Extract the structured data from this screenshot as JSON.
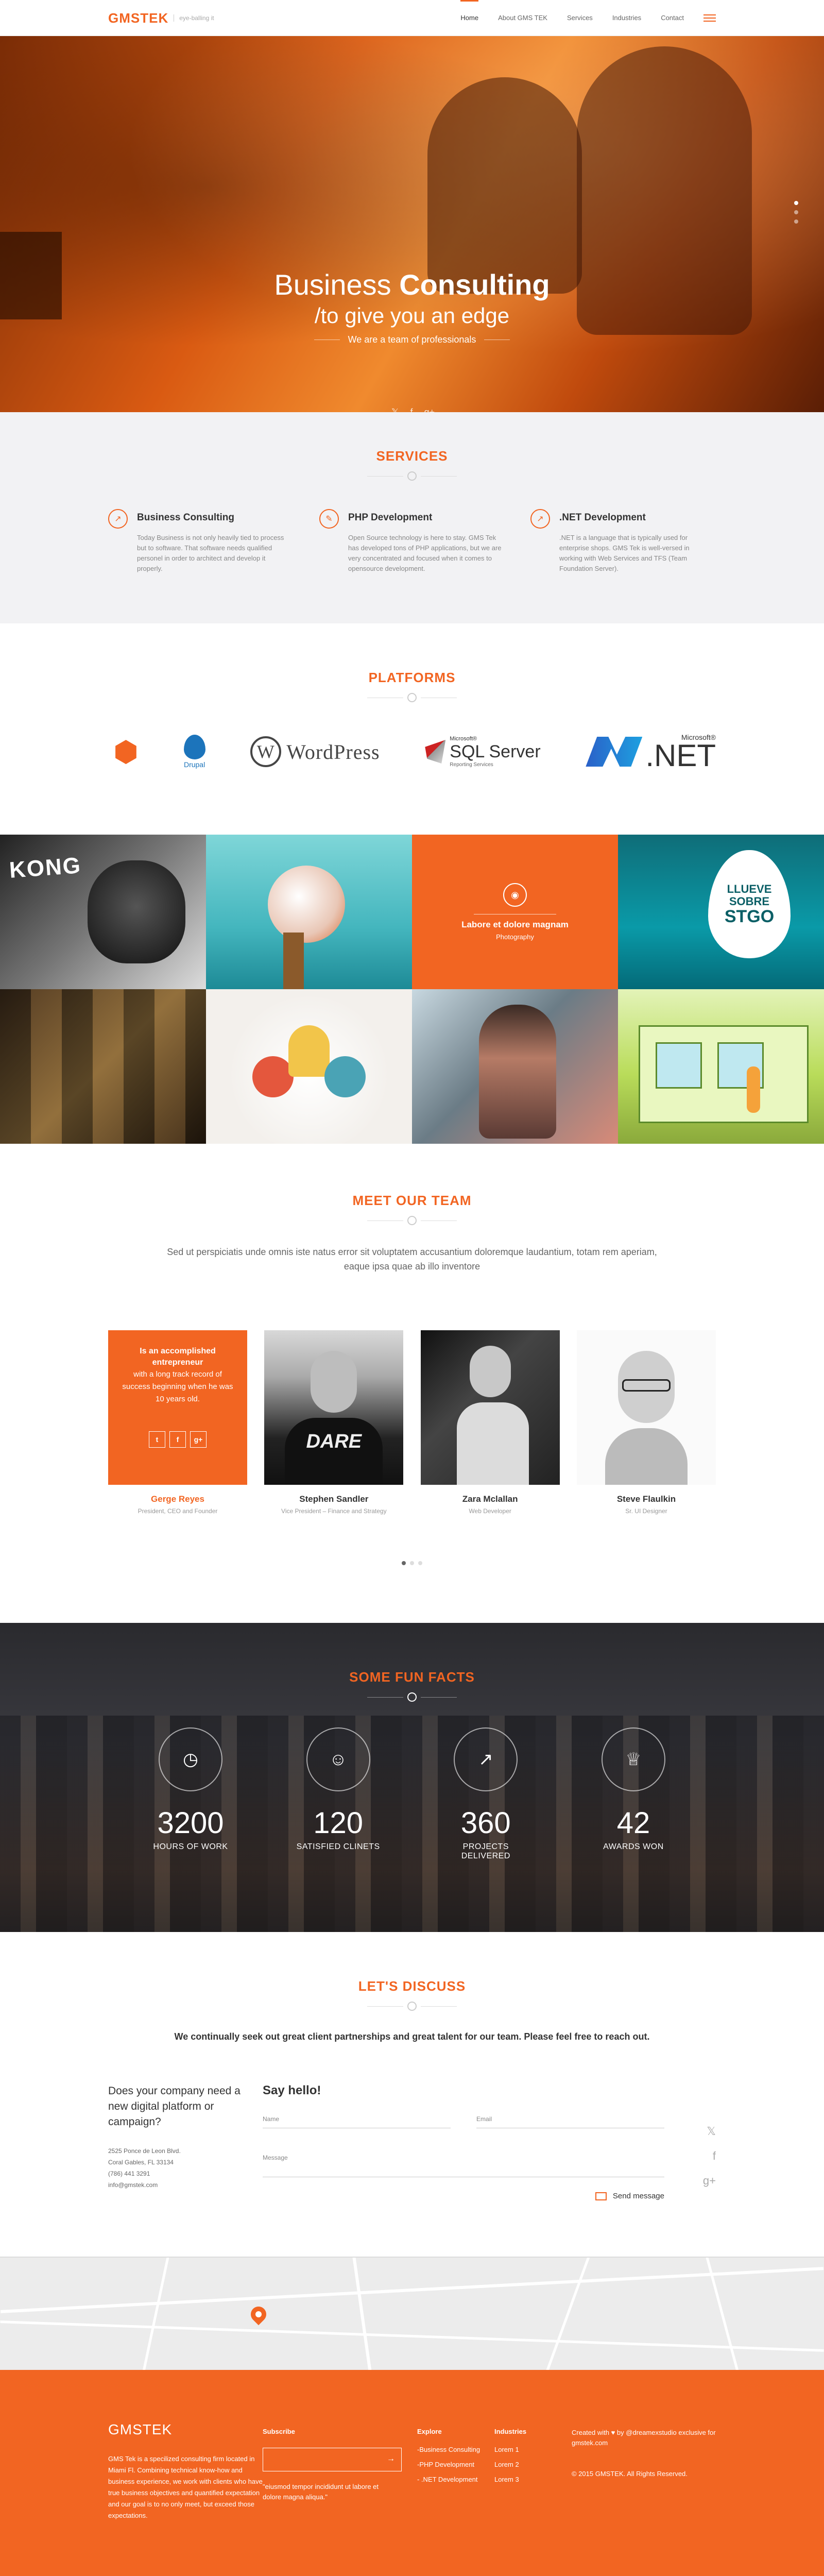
{
  "header": {
    "logo": "GMSTEK",
    "tagline": "eye-balling it",
    "nav": [
      "Home",
      "About GMS TEK",
      "Services",
      "Industries",
      "Contact"
    ]
  },
  "hero": {
    "title_a": "Business",
    "title_b": "Consulting",
    "subtitle": "/to give you an edge",
    "tagline": "We are a team of professionals",
    "social": [
      "twitter-icon",
      "facebook-icon",
      "google-plus-icon"
    ]
  },
  "services": {
    "heading": "SERVICES",
    "items": [
      {
        "title": "Business Consulting",
        "text": "Today Business is not only heavily tied to process but to software. That software needs qualified personel in order to architect and develop it properly.",
        "icon": "rocket-icon"
      },
      {
        "title": "PHP Development",
        "text": "Open Source technology is here to stay. GMS Tek has developed tons of PHP applications, but we are very concentrated and focused when it comes to opensource development.",
        "icon": "pencil-icon"
      },
      {
        "title": ".NET Development",
        "text": ".NET is a language that is typically used for enterprise shops. GMS Tek is well-versed in working with Web Services and TFS (Team Foundation Server).",
        "icon": "rocket-icon"
      }
    ]
  },
  "platforms": {
    "heading": "PLATFORMS",
    "drupal": "Drupal",
    "wordpress": "WordPress",
    "sql_ms": "Microsoft®",
    "sql_big": "SQL Server",
    "sql_rs": "Reporting Services",
    "net_ms": "Microsoft®",
    "net_big": ".NET"
  },
  "portfolio": {
    "kong": "KONG",
    "hover_title": "Labore et dolore magnam",
    "hover_sub": "Photography",
    "drop_1": "LLUEVE",
    "drop_2": "SOBRE",
    "drop_3": "STGO",
    "shirt": "DARE"
  },
  "team": {
    "heading": "MEET OUR TEAM",
    "intro": "Sed ut perspiciatis unde omnis iste natus error sit voluptatem accusantium doloremque laudantium, totam rem aperiam, eaque ipsa quae ab illo inventore",
    "bio_bold": "Is an accomplished entrepreneur",
    "bio_rest": "with a long track record of success beginning when he was 10 years old.",
    "members": [
      {
        "name": "Gerge Reyes",
        "role": "President, CEO and Founder"
      },
      {
        "name": "Stephen Sandler",
        "role": "Vice President – Finance and Strategy"
      },
      {
        "name": "Zara Mclallan",
        "role": "Web Developer"
      },
      {
        "name": "Steve Flaulkin",
        "role": "Sr. UI Designer"
      }
    ]
  },
  "facts": {
    "heading": "SOME FUN FACTS",
    "items": [
      {
        "num": "3200",
        "label": "HOURS OF WORK",
        "icon": "clock-icon"
      },
      {
        "num": "120",
        "label": "SATISFIED CLINETS",
        "icon": "user-icon"
      },
      {
        "num": "360",
        "label": "PROJECTS DELIVERED",
        "icon": "rocket-icon"
      },
      {
        "num": "42",
        "label": "AWARDS WON",
        "icon": "trophy-icon"
      }
    ]
  },
  "discuss": {
    "heading": "LET'S DISCUSS",
    "intro": "We continually seek out great client partnerships and great talent for our team. Please feel free to reach out.",
    "question": "Does your company need a new digital platform or campaign?",
    "address": [
      "2525 Ponce de Leon Blvd.",
      "Coral Gables, FL 33134",
      "(786) 441 3291",
      "info@gmstek.com"
    ],
    "form_title": "Say hello!",
    "name_label": "Name",
    "email_label": "Email",
    "message_label": "Message",
    "send": "Send message"
  },
  "footer": {
    "logo": "GMSTEK",
    "about": "GMS Tek is a specilized consulting firm located in Miami Fl. Combining technical know-how and business experience, we work with clients who have true business objectives and quantified expectation and our goal is to no only meet, but exceed those expectations.",
    "subscribe": "Subscribe",
    "quote": "\"eiusmod tempor incididunt ut labore et dolore magna aliqua.\"",
    "explore": "Explore",
    "explore_links": [
      "-Business Consulting",
      "-PHP Development",
      "- .NET Development"
    ],
    "industries": "Industries",
    "industry_links": [
      "Lorem 1",
      "Lorem 2",
      "Lorem 3"
    ],
    "credit": "Created with ♥ by @dreamexstudio exclusive for gmstek.com",
    "copyright": "© 2015 GMSTEK. All Rights Reserved."
  },
  "colors": {
    "accent": "#f26522"
  }
}
